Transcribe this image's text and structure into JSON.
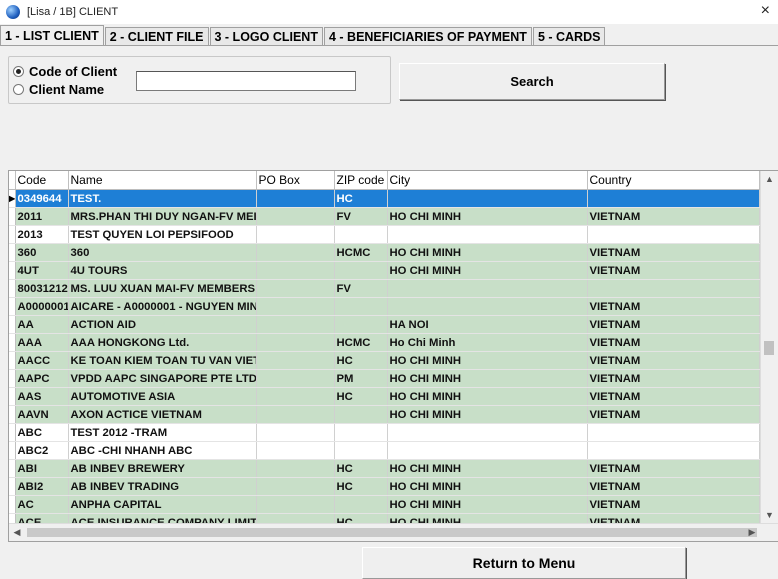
{
  "window": {
    "title": "[Lisa / 1B] CLIENT",
    "close": "×"
  },
  "tabs": [
    {
      "label": "1 - LIST CLIENT",
      "active": true
    },
    {
      "label": "2 - CLIENT FILE"
    },
    {
      "label": "3 - LOGO CLIENT"
    },
    {
      "label": "4 - BENEFICIARIES OF PAYMENT"
    },
    {
      "label": "5 - CARDS"
    }
  ],
  "search": {
    "option_code": "Code of Client",
    "option_name": "Client Name",
    "selected": "Code of Client",
    "value": "",
    "button": "Search"
  },
  "grid": {
    "columns": [
      "Code",
      "Name",
      "PO Box",
      "ZIP code",
      "City",
      "Country"
    ],
    "rows": [
      {
        "code": "0349644",
        "name": "TEST.",
        "po": "",
        "zip": "HC",
        "city": "",
        "country": "",
        "selected": true
      },
      {
        "code": "2011",
        "name": "MRS.PHAN THI DUY NGAN-FV MEI",
        "po": "",
        "zip": "FV",
        "city": "HO CHI MINH",
        "country": "VIETNAM"
      },
      {
        "code": "2013",
        "name": "TEST QUYEN LOI PEPSIFOOD",
        "po": "",
        "zip": "",
        "city": "",
        "country": ""
      },
      {
        "code": "360",
        "name": "360",
        "po": "",
        "zip": "HCMC",
        "city": "HO CHI MINH",
        "country": "VIETNAM"
      },
      {
        "code": "4UT",
        "name": "4U TOURS",
        "po": "",
        "zip": "",
        "city": "HO CHI MINH",
        "country": "VIETNAM"
      },
      {
        "code": "80031212",
        "name": "MS. LUU XUAN MAI-FV MEMBERS",
        "po": "",
        "zip": "FV",
        "city": "",
        "country": ""
      },
      {
        "code": "A0000001",
        "name": "AICARE - A0000001 - NGUYEN MIN",
        "po": "",
        "zip": "",
        "city": "",
        "country": "VIETNAM"
      },
      {
        "code": "AA",
        "name": "ACTION AID",
        "po": "",
        "zip": "",
        "city": "HA NOI",
        "country": "VIETNAM"
      },
      {
        "code": "AAA",
        "name": "AAA HONGKONG Ltd.",
        "po": "",
        "zip": "HCMC",
        "city": "Ho Chi Minh",
        "country": "VIETNAM"
      },
      {
        "code": "AACC",
        "name": "KE TOAN KIEM TOAN TU VAN VIET",
        "po": "",
        "zip": "HC",
        "city": "HO CHI MINH",
        "country": "VIETNAM"
      },
      {
        "code": "AAPC",
        "name": "VPDD AAPC SINGAPORE PTE LTD",
        "po": "",
        "zip": "PM",
        "city": "HO CHI MINH",
        "country": "VIETNAM"
      },
      {
        "code": "AAS",
        "name": "AUTOMOTIVE ASIA",
        "po": "",
        "zip": "HC",
        "city": "HO CHI MINH",
        "country": "VIETNAM"
      },
      {
        "code": "AAVN",
        "name": "AXON ACTICE VIETNAM",
        "po": "",
        "zip": "",
        "city": "HO CHI MINH",
        "country": "VIETNAM"
      },
      {
        "code": "ABC",
        "name": "TEST 2012 -TRAM",
        "po": "",
        "zip": "",
        "city": "",
        "country": ""
      },
      {
        "code": "ABC2",
        "name": "ABC -CHI NHANH ABC",
        "po": "",
        "zip": "",
        "city": "",
        "country": ""
      },
      {
        "code": "ABI",
        "name": "AB INBEV BREWERY",
        "po": "",
        "zip": "HC",
        "city": "HO CHI MINH",
        "country": "VIETNAM"
      },
      {
        "code": "ABI2",
        "name": "AB INBEV TRADING",
        "po": "",
        "zip": "HC",
        "city": "HO CHI MINH",
        "country": "VIETNAM"
      },
      {
        "code": "AC",
        "name": "ANPHA CAPITAL",
        "po": "",
        "zip": "",
        "city": "HO CHI MINH",
        "country": "VIETNAM"
      },
      {
        "code": "ACE",
        "name": "ACE INSURANCE COMPANY LIMIT",
        "po": "",
        "zip": "HC",
        "city": "HO CHI MINH",
        "country": "VIETNAM"
      }
    ]
  },
  "footer": {
    "return_button": "Return to Menu"
  },
  "colors": {
    "selected_row": "#1e7fd6",
    "stripe": "#c8dfc8"
  }
}
